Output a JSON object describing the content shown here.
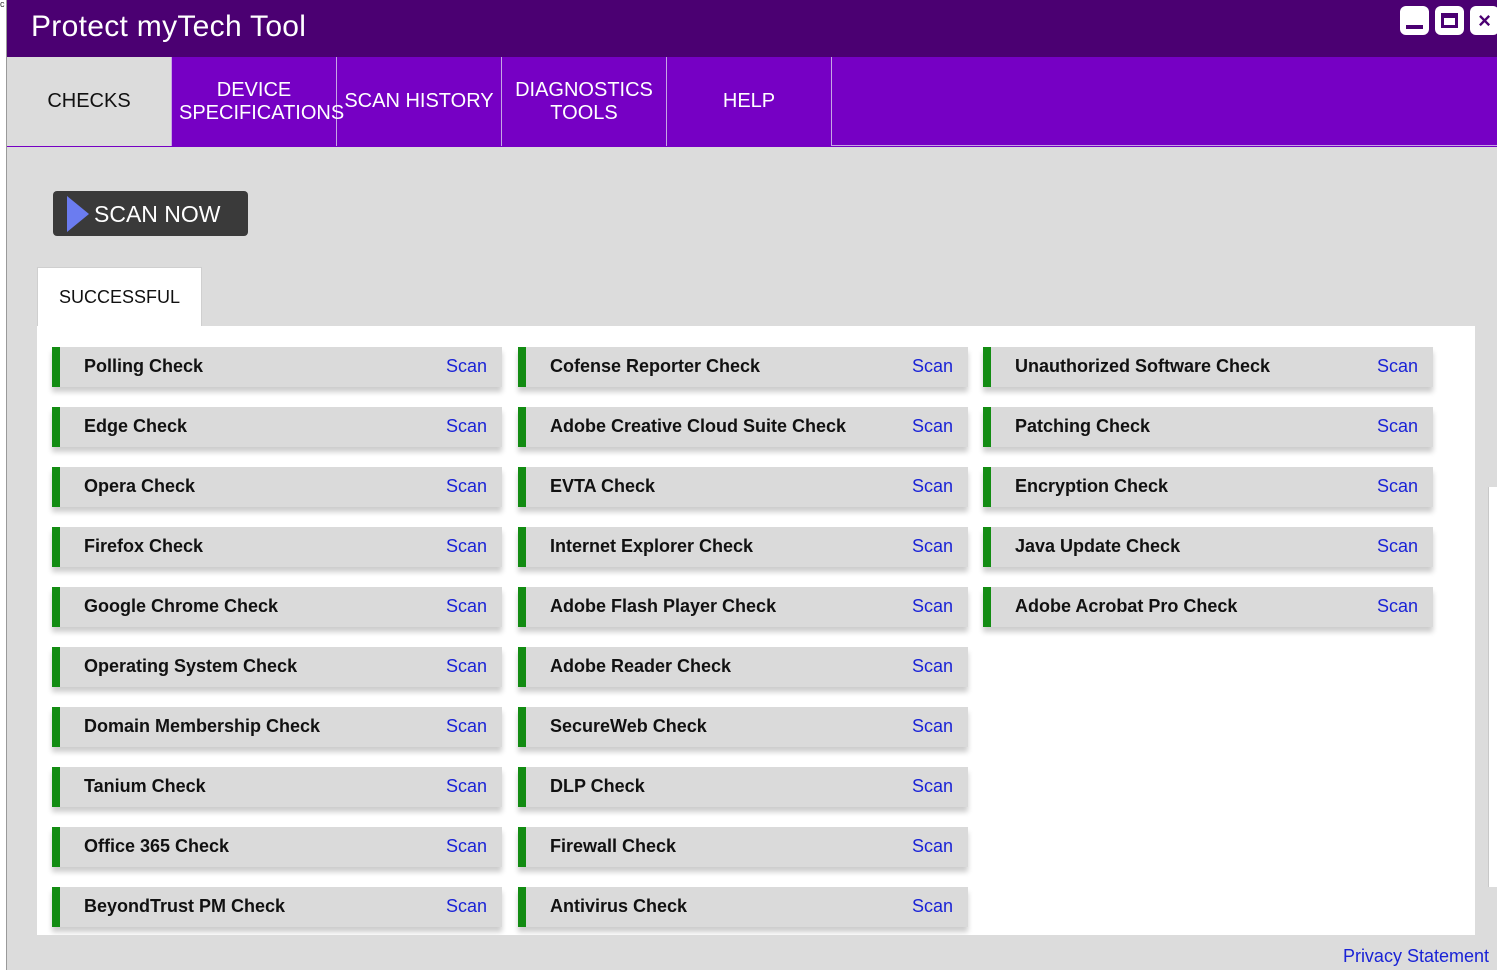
{
  "window": {
    "title": "Protect myTech Tool",
    "controls": {
      "minimize": "minimize",
      "maximize": "maximize",
      "close": "×"
    }
  },
  "colors": {
    "titlebar": "#4b0072",
    "tabbar": "#7600c4",
    "status_success": "#138c13",
    "link": "#1a23d6"
  },
  "tabs": [
    {
      "label": "CHECKS",
      "active": true
    },
    {
      "label": "DEVICE SPECIFICATIONS",
      "active": false
    },
    {
      "label": "SCAN HISTORY",
      "active": false
    },
    {
      "label": "DIAGNOSTICS TOOLS",
      "active": false
    },
    {
      "label": "HELP",
      "active": false
    }
  ],
  "scan_now": {
    "label": "SCAN NOW",
    "icon": "play-icon"
  },
  "result_tab": {
    "label": "SUCCESSFUL"
  },
  "check_action_label": "Scan",
  "checks": {
    "column1": [
      "Polling Check",
      "Edge Check",
      "Opera Check",
      "Firefox Check",
      "Google Chrome Check",
      "Operating System Check",
      "Domain Membership Check",
      "Tanium Check",
      "Office 365 Check",
      "BeyondTrust PM Check"
    ],
    "column2": [
      "Cofense Reporter Check",
      "Adobe Creative Cloud Suite Check",
      "EVTA Check",
      "Internet Explorer Check",
      "Adobe Flash Player Check",
      "Adobe Reader Check",
      "SecureWeb Check",
      "DLP Check",
      "Firewall Check",
      "Antivirus Check"
    ],
    "column3": [
      "Unauthorized Software Check",
      "Patching Check",
      "Encryption Check",
      "Java Update Check",
      "Adobe Acrobat Pro Check"
    ]
  },
  "footer": {
    "privacy_label": "Privacy Statement"
  }
}
